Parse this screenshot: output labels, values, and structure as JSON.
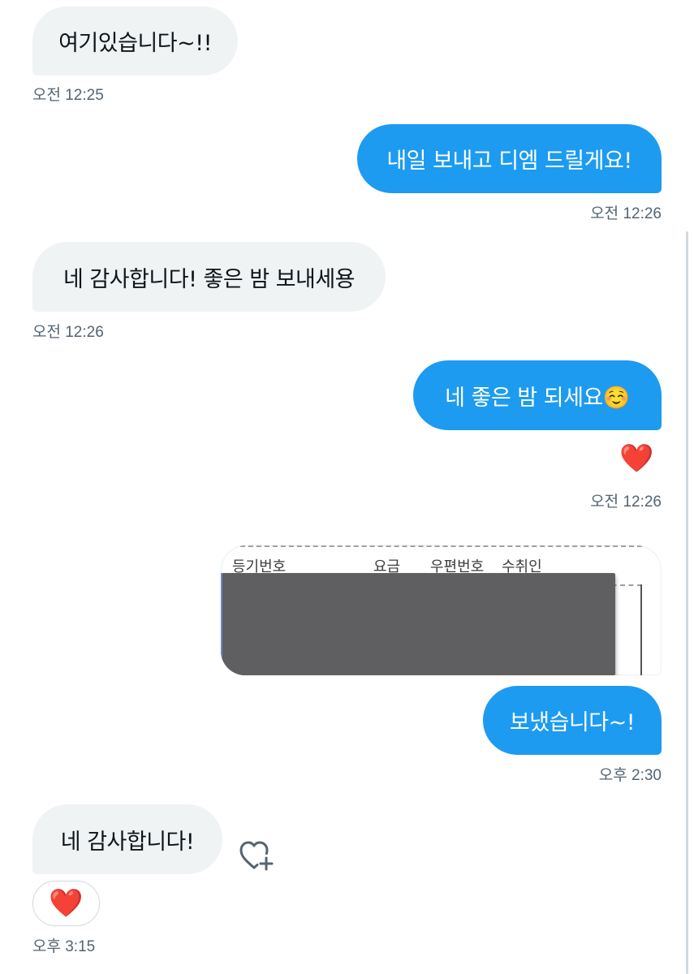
{
  "messages": [
    {
      "id": "m1",
      "side": "received",
      "text": "여기있습니다~!!",
      "time": "오전 12:25"
    },
    {
      "id": "m2",
      "side": "sent",
      "text": "내일 보내고 디엠 드릴게요!",
      "time": "오전 12:26"
    },
    {
      "id": "m3",
      "side": "received",
      "text": "네 감사합니다! 좋은 밤 보내세용",
      "time": "오전 12:26"
    },
    {
      "id": "m4",
      "side": "sent",
      "text": "네 좋은 밤 되세요☺️",
      "reaction": "❤️",
      "time": "오전 12:26"
    },
    {
      "id": "m5",
      "side": "sent",
      "type": "image",
      "image_headers": [
        "등기번호",
        "요금",
        "우편번호",
        "수취인"
      ]
    },
    {
      "id": "m6",
      "side": "sent",
      "text": "보냈습니다~!",
      "time": "오후 2:30"
    },
    {
      "id": "m7",
      "side": "received",
      "text": "네 감사합니다!",
      "reaction": "❤️",
      "time": "오후 3:15"
    }
  ],
  "icons": {
    "add_reaction": "heart-plus-icon"
  },
  "colors": {
    "sent_bubble": "#1d9bf0",
    "received_bubble": "#eff3f4",
    "timestamp": "#536471",
    "heart": "#f4212e"
  }
}
